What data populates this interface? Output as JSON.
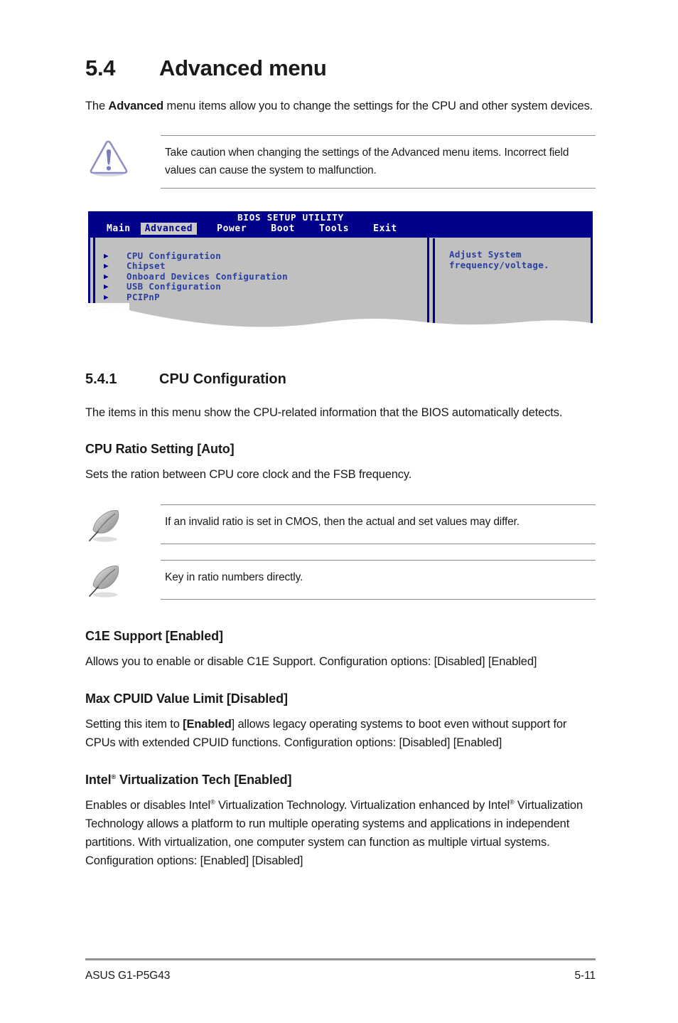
{
  "section": {
    "number": "5.4",
    "title": "Advanced menu",
    "intro_prefix": "The ",
    "intro_bold": "Advanced",
    "intro_suffix": " menu items allow you to change the settings for the CPU and other system devices."
  },
  "caution": {
    "icon": "warning-triangle-icon",
    "text": "Take caution when changing the settings of the Advanced menu items. Incorrect field values can cause the system to malfunction."
  },
  "bios": {
    "utility_title": "BIOS SETUP UTILITY",
    "tabs": [
      {
        "label": "Main",
        "active": false
      },
      {
        "label": "Advanced",
        "active": true
      },
      {
        "label": "Power",
        "active": false
      },
      {
        "label": "Boot",
        "active": false
      },
      {
        "label": "Tools",
        "active": false
      },
      {
        "label": "Exit",
        "active": false
      }
    ],
    "menu_items": [
      "CPU Configuration",
      "Chipset",
      "Onboard Devices Configuration",
      "USB Configuration",
      "PCIPnP"
    ],
    "help_text": "Adjust System\nfrequency/voltage.",
    "colors": {
      "titlebar": "#00008b",
      "body": "#c0c0c0",
      "text": "#2b3fa0",
      "active_tab_bg": "#c8c8c8"
    }
  },
  "subsection": {
    "number": "5.4.1",
    "title": "CPU Configuration",
    "intro": "The items in this menu show the CPU-related information that the BIOS automatically detects."
  },
  "items": {
    "cpu_ratio": {
      "heading": "CPU Ratio Setting [Auto]",
      "body": "Sets the ration between CPU core clock and the FSB frequency."
    },
    "note1": {
      "icon": "quill-note-icon",
      "text": "If an invalid ratio is set in CMOS, then the actual and set values may differ."
    },
    "note2": {
      "icon": "quill-note-icon",
      "text": "Key in ratio numbers directly."
    },
    "c1e": {
      "heading": "C1E Support [Enabled]",
      "body": "Allows you to enable or disable C1E Support. Configuration options: [Disabled] [Enabled]"
    },
    "max_cpuid": {
      "heading": "Max CPUID Value Limit [Disabled]",
      "body_part1": "Setting this item to ",
      "body_bold": "[Enabled",
      "body_part2": "] allows legacy operating systems to boot even without support for CPUs with extended CPUID functions. Configuration options: [Disabled] [Enabled]"
    },
    "virtualization": {
      "heading_part1": "Intel",
      "heading_reg": "®",
      "heading_part2": " Virtualization Tech [Enabled]",
      "body_part1": "Enables or disables Intel",
      "body_reg1": "®",
      "body_part2": " Virtualization Technology. Virtualization enhanced by Intel",
      "body_reg2": "®",
      "body_part3": " Virtualization Technology allows a platform to run multiple operating systems and applications in independent partitions. With virtualization, one computer system can function as multiple virtual systems. Configuration options: [Enabled] [Disabled]"
    }
  },
  "footer": {
    "left": "ASUS G1-P5G43",
    "right": "5-11"
  }
}
